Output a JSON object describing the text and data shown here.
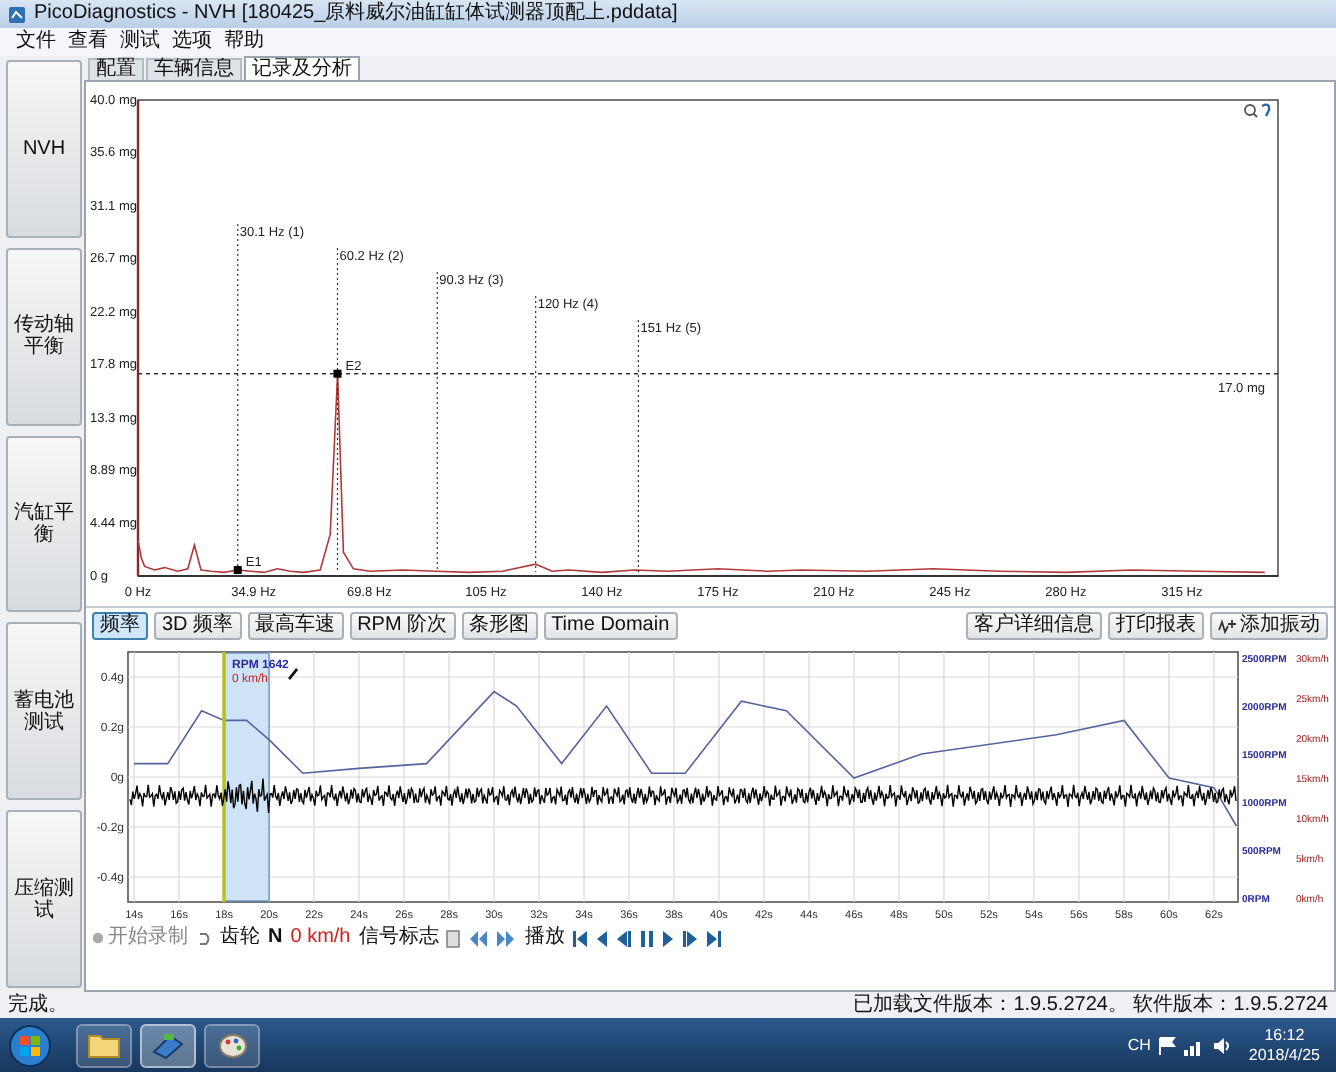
{
  "window": {
    "title": "PicoDiagnostics - NVH [180425_原料威尔油缸缸体试测器顶配上.pddata]"
  },
  "menu": [
    "文件",
    "查看",
    "测试",
    "选项",
    "帮助"
  ],
  "sidebar": {
    "items": [
      {
        "label": "NVH"
      },
      {
        "label": "传动轴平衡"
      },
      {
        "label": "汽缸平衡"
      },
      {
        "label": "蓄电池测试"
      },
      {
        "label": "压缩测试"
      }
    ]
  },
  "tabs": [
    {
      "label": "配置",
      "selected": false
    },
    {
      "label": "车辆信息",
      "selected": false
    },
    {
      "label": "记录及分析",
      "selected": true
    }
  ],
  "spectrum": {
    "chart_data": {
      "type": "line",
      "xlim": [
        0,
        344
      ],
      "ylim": [
        0,
        40
      ],
      "x": [
        0,
        1,
        2,
        5,
        8,
        12,
        15,
        17,
        19,
        22,
        26,
        30.1,
        34,
        38,
        42,
        46,
        50,
        55,
        58,
        60.2,
        62,
        65,
        70,
        80,
        90,
        100,
        110,
        120,
        125,
        130,
        140,
        150,
        160,
        175,
        190,
        200,
        220,
        240,
        260,
        280,
        300,
        320,
        340
      ],
      "series": [
        {
          "color": "#b03a3a",
          "values": [
            3.0,
            1.5,
            0.8,
            0.5,
            0.7,
            0.4,
            0.6,
            2.6,
            0.5,
            0.4,
            0.3,
            0.5,
            0.4,
            0.3,
            0.6,
            0.4,
            0.3,
            0.5,
            3.5,
            17.0,
            2.0,
            0.6,
            0.4,
            0.5,
            0.4,
            0.3,
            0.4,
            1.0,
            0.4,
            0.5,
            0.3,
            0.5,
            0.4,
            0.6,
            0.4,
            0.5,
            0.4,
            0.6,
            0.4,
            0.3,
            0.5,
            0.4,
            0.3
          ]
        }
      ],
      "xticks": [
        {
          "value": 0,
          "label": "0 Hz"
        },
        {
          "value": 34.9,
          "label": "34.9 Hz"
        },
        {
          "value": 69.8,
          "label": "69.8 Hz"
        },
        {
          "value": 105,
          "label": "105 Hz"
        },
        {
          "value": 140,
          "label": "140 Hz"
        },
        {
          "value": 175,
          "label": "175 Hz"
        },
        {
          "value": 210,
          "label": "210 Hz"
        },
        {
          "value": 245,
          "label": "245 Hz"
        },
        {
          "value": 280,
          "label": "280 Hz"
        },
        {
          "value": 315,
          "label": "315 Hz"
        }
      ],
      "yticks": [
        {
          "value": 0,
          "label": "0 g"
        },
        {
          "value": 4.44,
          "label": "4.44 mg"
        },
        {
          "value": 8.89,
          "label": "8.89 mg"
        },
        {
          "value": 13.3,
          "label": "13.3 mg"
        },
        {
          "value": 17.8,
          "label": "17.8 mg"
        },
        {
          "value": 22.2,
          "label": "22.2 mg"
        },
        {
          "value": 26.7,
          "label": "26.7 mg"
        },
        {
          "value": 31.1,
          "label": "31.1 mg"
        },
        {
          "value": 35.6,
          "label": "35.6 mg"
        },
        {
          "value": 40,
          "label": "40.0 mg"
        }
      ],
      "ref_lines": [
        {
          "axis": "x",
          "value": 30.1,
          "label": "30.1 Hz (1)"
        },
        {
          "axis": "x",
          "value": 60.2,
          "label": "60.2 Hz (2)"
        },
        {
          "axis": "x",
          "value": 90.3,
          "label": "90.3 Hz (3)"
        },
        {
          "axis": "x",
          "value": 120,
          "label": "120 Hz (4)"
        },
        {
          "axis": "x",
          "value": 151,
          "label": "151 Hz (5)"
        },
        {
          "axis": "y",
          "value": 17.0,
          "label": "17.0 mg"
        }
      ],
      "annotations": [
        {
          "x": 30.1,
          "y": 0.5,
          "text": "E1"
        },
        {
          "x": 60.2,
          "y": 17.0,
          "text": "E2"
        }
      ]
    }
  },
  "toolbar": {
    "left_buttons": [
      {
        "label": "频率",
        "selected": true
      },
      {
        "label": "3D 频率",
        "selected": false
      },
      {
        "label": "最高车速",
        "selected": false
      },
      {
        "label": "RPM 阶次",
        "selected": false
      },
      {
        "label": "条形图",
        "selected": false
      },
      {
        "label": "Time Domain",
        "selected": false
      }
    ],
    "right_buttons": [
      {
        "label": "客户详细信息",
        "kind": "text"
      },
      {
        "label": "打印报表",
        "kind": "text"
      },
      {
        "label": "添加振动",
        "kind": "icon"
      }
    ]
  },
  "time_chart": {
    "chart_data": {
      "type": "line",
      "xlim": [
        13.73,
        63.07
      ],
      "ylim": [
        -42,
        2562
      ],
      "x": [
        14,
        15.5,
        17,
        18,
        19,
        20,
        21.5,
        24,
        27,
        30,
        31,
        33,
        35,
        37,
        38.5,
        41,
        43,
        46,
        49,
        55,
        58,
        60,
        62,
        63
      ],
      "series": [
        {
          "color": "#5563a0",
          "values": [
            1400,
            1400,
            1950,
            1850,
            1850,
            1650,
            1300,
            1350,
            1400,
            2150,
            2000,
            1400,
            2000,
            1300,
            1300,
            2050,
            1950,
            1250,
            1500,
            1700,
            1850,
            1250,
            1150,
            750
          ]
        }
      ],
      "grid": true,
      "bands": [
        {
          "axis": "x",
          "from": 18,
          "to": 20
        }
      ],
      "ref_lines": [
        {
          "axis": "x",
          "value": 18
        }
      ],
      "xticks": [
        {
          "value": 14,
          "label": "14s"
        },
        {
          "value": 16,
          "label": "16s"
        },
        {
          "value": 18,
          "label": "18s"
        },
        {
          "value": 20,
          "label": "20s"
        },
        {
          "value": 22,
          "label": "22s"
        },
        {
          "value": 24,
          "label": "24s"
        },
        {
          "value": 26,
          "label": "26s"
        },
        {
          "value": 28,
          "label": "28s"
        },
        {
          "value": 30,
          "label": "30s"
        },
        {
          "value": 32,
          "label": "32s"
        },
        {
          "value": 34,
          "label": "34s"
        },
        {
          "value": 36,
          "label": "36s"
        },
        {
          "value": 38,
          "label": "38s"
        },
        {
          "value": 40,
          "label": "40s"
        },
        {
          "value": 42,
          "label": "42s"
        },
        {
          "value": 44,
          "label": "44s"
        },
        {
          "value": 46,
          "label": "46s"
        },
        {
          "value": 48,
          "label": "48s"
        },
        {
          "value": 50,
          "label": "50s"
        },
        {
          "value": 52,
          "label": "52s"
        },
        {
          "value": 54,
          "label": "54s"
        },
        {
          "value": 56,
          "label": "56s"
        },
        {
          "value": 58,
          "label": "58s"
        },
        {
          "value": 60,
          "label": "60s"
        },
        {
          "value": 62,
          "label": "62s"
        }
      ],
      "yticks": [
        {
          "value": 0,
          "label": "0RPM"
        },
        {
          "value": 500,
          "label": "500RPM"
        },
        {
          "value": 1000,
          "label": "1000RPM"
        },
        {
          "value": 1500,
          "label": "1500RPM"
        },
        {
          "value": 2000,
          "label": "2000RPM"
        },
        {
          "value": 2500,
          "label": "2500RPM"
        }
      ]
    },
    "left_axis_labels": [
      "0.4g",
      "0.2g",
      "0g",
      "-0.2g",
      "-0.4g"
    ],
    "speed_axis_labels": [
      "30km/h",
      "25km/h",
      "20km/h",
      "15km/h",
      "10km/h",
      "5km/h",
      "0km/h"
    ],
    "cursor_readout": {
      "rpm": "RPM 1642",
      "speed": "0 km/h"
    }
  },
  "playback": {
    "record_label": "开始录制",
    "gear_label": "齿轮",
    "gear_value": "N",
    "speed": "0 km/h",
    "signal_label": "信号标志",
    "play_label": "播放"
  },
  "status_bar": {
    "message": "完成。",
    "version": "已加载文件版本：1.9.5.2724。 软件版本：1.9.5.2724"
  },
  "taskbar": {
    "tray_text": "CH",
    "time": "16:12",
    "date": "2018/4/25"
  }
}
